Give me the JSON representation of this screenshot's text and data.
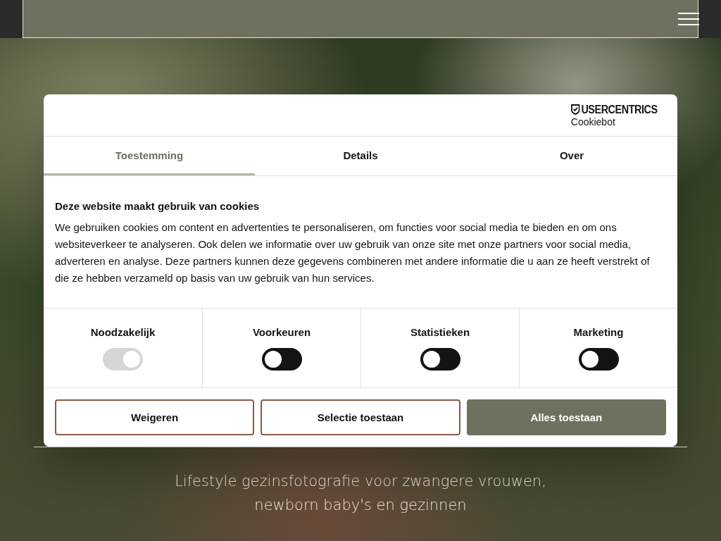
{
  "dialog": {
    "brand": {
      "name": "USERCENTRICS",
      "product": "Cookiebot"
    },
    "tabs": [
      {
        "label": "Toestemming",
        "selected": true
      },
      {
        "label": "Details",
        "selected": false
      },
      {
        "label": "Over",
        "selected": false
      }
    ],
    "heading": "Deze website maakt gebruik van cookies",
    "body": "We gebruiken cookies om content en advertenties te personaliseren, om functies voor social media te bieden en om ons websiteverkeer te analyseren. Ook delen we informatie over uw gebruik van onze site met onze partners voor social media, adverteren en analyse. Deze partners kunnen deze gegevens combineren met andere informatie die u aan ze heeft verstrekt of die ze hebben verzameld op basis van uw gebruik van hun services.",
    "categories": [
      {
        "label": "Noodzakelijk",
        "checked": true,
        "disabled": true
      },
      {
        "label": "Voorkeuren",
        "checked": false,
        "disabled": false
      },
      {
        "label": "Statistieken",
        "checked": false,
        "disabled": false
      },
      {
        "label": "Marketing",
        "checked": false,
        "disabled": false
      }
    ],
    "buttons": [
      {
        "label": "Weigeren",
        "kind": "outline"
      },
      {
        "label": "Selectie toestaan",
        "kind": "outline"
      },
      {
        "label": "Alles toestaan",
        "kind": "filled"
      }
    ]
  },
  "hero": {
    "tagline_lines": [
      "Lifestyle gezinsfotografie voor zwangere vrouwen,",
      "newborn baby's en gezinnen"
    ]
  }
}
